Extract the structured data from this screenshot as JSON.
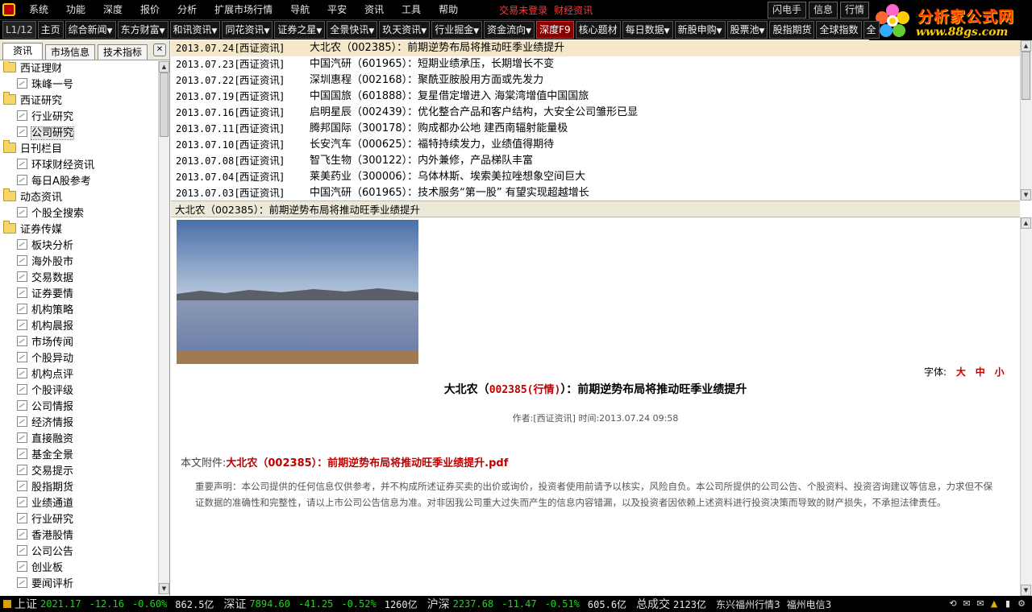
{
  "menubar": {
    "items": [
      "系统",
      "功能",
      "深度",
      "报价",
      "分析",
      "扩展市场行情",
      "导航",
      "平安",
      "资讯",
      "工具",
      "帮助"
    ],
    "login_status": "交易未登录",
    "finance_news": "财经资讯",
    "right_buttons": [
      "闪电手",
      "信息",
      "行情"
    ]
  },
  "logo": {
    "title": "分析家公式网",
    "url": "www.88gs.com"
  },
  "toolbar": {
    "page": "L1/12",
    "buttons": [
      {
        "label": "主页",
        "dropdown": false
      },
      {
        "label": "综合新闻",
        "dropdown": true
      },
      {
        "label": "东方财富",
        "dropdown": true
      },
      {
        "label": "和讯资讯",
        "dropdown": true
      },
      {
        "label": "同花资讯",
        "dropdown": true
      },
      {
        "label": "证券之星",
        "dropdown": true
      },
      {
        "label": "全景快讯",
        "dropdown": true
      },
      {
        "label": "玖天资讯",
        "dropdown": true
      },
      {
        "label": "行业掘金",
        "dropdown": true
      },
      {
        "label": "资金流向",
        "dropdown": true
      },
      {
        "label": "深度F9",
        "dropdown": false,
        "highlight": true
      },
      {
        "label": "核心题材",
        "dropdown": false
      },
      {
        "label": "每日数据",
        "dropdown": true
      },
      {
        "label": "新股申购",
        "dropdown": true
      },
      {
        "label": "股票池",
        "dropdown": true
      },
      {
        "label": "股指期货",
        "dropdown": false
      },
      {
        "label": "全球指数",
        "dropdown": false
      },
      {
        "label": "全",
        "dropdown": false
      }
    ]
  },
  "left_tabs": [
    "资讯",
    "市场信息",
    "技术指标"
  ],
  "tree": [
    {
      "label": "西证理财",
      "type": "folder"
    },
    {
      "label": "珠峰一号",
      "type": "item"
    },
    {
      "label": "西证研究",
      "type": "folder"
    },
    {
      "label": "行业研究",
      "type": "item"
    },
    {
      "label": "公司研究",
      "type": "item",
      "selected": true
    },
    {
      "label": "日刊栏目",
      "type": "folder"
    },
    {
      "label": "环球财经资讯",
      "type": "item"
    },
    {
      "label": "每日A股参考",
      "type": "item"
    },
    {
      "label": "动态资讯",
      "type": "folder"
    },
    {
      "label": "个股全搜索",
      "type": "item"
    },
    {
      "label": "证券传媒",
      "type": "folder"
    },
    {
      "label": "板块分析",
      "type": "item"
    },
    {
      "label": "海外股市",
      "type": "item"
    },
    {
      "label": "交易数据",
      "type": "item"
    },
    {
      "label": "证券要情",
      "type": "item"
    },
    {
      "label": "机构策略",
      "type": "item"
    },
    {
      "label": "机构晨报",
      "type": "item"
    },
    {
      "label": "市场传闻",
      "type": "item"
    },
    {
      "label": "个股异动",
      "type": "item"
    },
    {
      "label": "机构点评",
      "type": "item"
    },
    {
      "label": "个股评级",
      "type": "item"
    },
    {
      "label": "公司情报",
      "type": "item"
    },
    {
      "label": "经济情报",
      "type": "item"
    },
    {
      "label": "直接融资",
      "type": "item"
    },
    {
      "label": "基金全景",
      "type": "item"
    },
    {
      "label": "交易提示",
      "type": "item"
    },
    {
      "label": "股指期货",
      "type": "item"
    },
    {
      "label": "业绩通道",
      "type": "item"
    },
    {
      "label": "行业研究",
      "type": "item"
    },
    {
      "label": "香港股情",
      "type": "item"
    },
    {
      "label": "公司公告",
      "type": "item"
    },
    {
      "label": "创业板",
      "type": "item"
    },
    {
      "label": "要闻评析",
      "type": "item"
    }
  ],
  "news": [
    {
      "date": "2013.07.24",
      "source": "[西证资讯]",
      "title": "大北农（002385）：前期逆势布局将推动旺季业绩提升",
      "selected": true
    },
    {
      "date": "2013.07.23",
      "source": "[西证资讯]",
      "title": "中国汽研（601965）：短期业绩承压，长期增长不变"
    },
    {
      "date": "2013.07.22",
      "source": "[西证资讯]",
      "title": "深圳惠程（002168）：聚酰亚胺股用方面或先发力"
    },
    {
      "date": "2013.07.19",
      "source": "[西证资讯]",
      "title": "中国国旅（601888）：复星借定增进入 海棠湾增值中国国旅"
    },
    {
      "date": "2013.07.16",
      "source": "[西证资讯]",
      "title": "启明星辰（002439）：优化整合产品和客户结构，大安全公司雏形已显"
    },
    {
      "date": "2013.07.11",
      "source": "[西证资讯]",
      "title": "腾邦国际（300178）：购成都办公地 建西南辐射能量极"
    },
    {
      "date": "2013.07.10",
      "source": "[西证资讯]",
      "title": "长安汽车（000625）：福特持续发力，业绩值得期待"
    },
    {
      "date": "2013.07.08",
      "source": "[西证资讯]",
      "title": "智飞生物（300122）：内外兼修，产品梯队丰富"
    },
    {
      "date": "2013.07.04",
      "source": "[西证资讯]",
      "title": "莱美药业（300006）：乌体林斯、埃索美拉唑想象空间巨大"
    },
    {
      "date": "2013.07.03",
      "source": "[西证资讯]",
      "title": "中国汽研（601965）：技术服务“第一股” 有望实现超越增长"
    }
  ],
  "article": {
    "bar_title": "大北农（002385）：前期逆势布局将推动旺季业绩提升",
    "font_label": "字体:",
    "font_sizes": [
      "大",
      "中",
      "小"
    ],
    "headline_pre": "大北农（",
    "headline_code": "002385(行情)",
    "headline_post": "）：前期逆势布局将推动旺季业绩提升",
    "meta": "作者:[西证资讯] 时间:2013.07.24 09:58",
    "attachment_label": "本文附件:",
    "attachment_file": "大北农（002385）：前期逆势布局将推动旺季业绩提升.pdf",
    "disclaimer": "重要声明：本公司提供的任何信息仅供参考，并不构成所述证券买卖的出价或询价，投资者使用前请予以核实，风险自负。本公司所提供的公司公告、个股资料、投资咨询建议等信息，力求但不保证数据的准确性和完整性，请以上市公司公告信息为准。对非因我公司重大过失而产生的信息内容错漏，以及投资者因依赖上述资料进行投资决策而导致的财产损失，不承担法律责任。"
  },
  "statusbar": {
    "indices": [
      {
        "name": "上证",
        "value": "2021.17",
        "change": "-12.16",
        "pct": "-0.60%",
        "amount": "862.5亿"
      },
      {
        "name": "深证",
        "value": "7894.60",
        "change": "-41.25",
        "pct": "-0.52%",
        "amount": "1260亿"
      },
      {
        "name": "沪深",
        "value": "2237.68",
        "change": "-11.47",
        "pct": "-0.51%",
        "amount": "605.6亿"
      }
    ],
    "total_label": "总成交",
    "total_value": "2123亿",
    "connections": [
      "东兴福州行情3",
      "福州电信3"
    ]
  },
  "colors": {
    "accent_red": "#c00000",
    "gain_green": "#18d818",
    "selected_row": "#f5e7c9"
  }
}
